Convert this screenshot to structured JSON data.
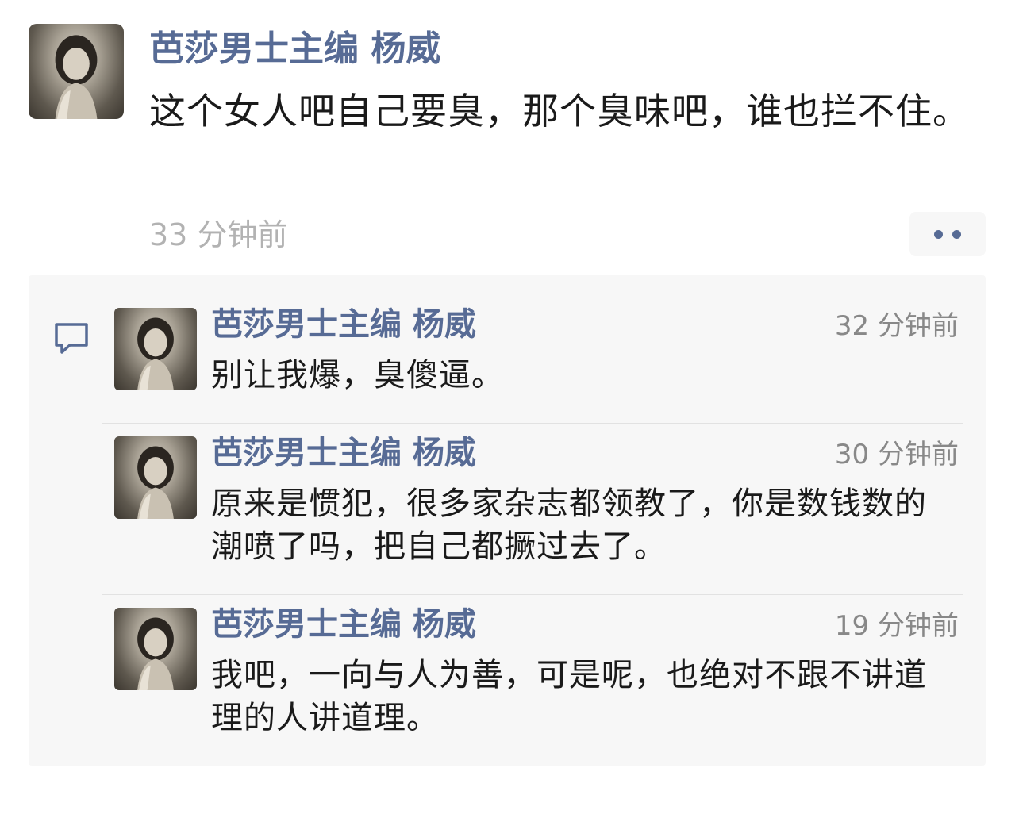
{
  "post": {
    "author": "芭莎男士主编 杨威",
    "text": "这个女人吧自己要臭，那个臭味吧，谁也拦不住。",
    "time": "33 分钟前",
    "avatar_icon": "portrait-avatar-icon",
    "more_icon": "more-dots-icon"
  },
  "comments_section": {
    "icon": "comment-bubble-icon",
    "items": [
      {
        "author": "芭莎男士主编 杨威",
        "time": "32 分钟前",
        "text": "别让我爆，臭傻逼。"
      },
      {
        "author": "芭莎男士主编 杨威",
        "time": "30 分钟前",
        "text": "原来是惯犯，很多家杂志都领教了，你是数钱数的潮喷了吗，把自己都撅过去了。"
      },
      {
        "author": "芭莎男士主编 杨威",
        "time": "19 分钟前",
        "text": "我吧，一向与人为善，可是呢，也绝对不跟不讲道理的人讲道理。"
      }
    ]
  },
  "colors": {
    "name_link": "#576b95",
    "time_text": "#b2b2b2",
    "comment_bg": "#f7f7f7"
  }
}
